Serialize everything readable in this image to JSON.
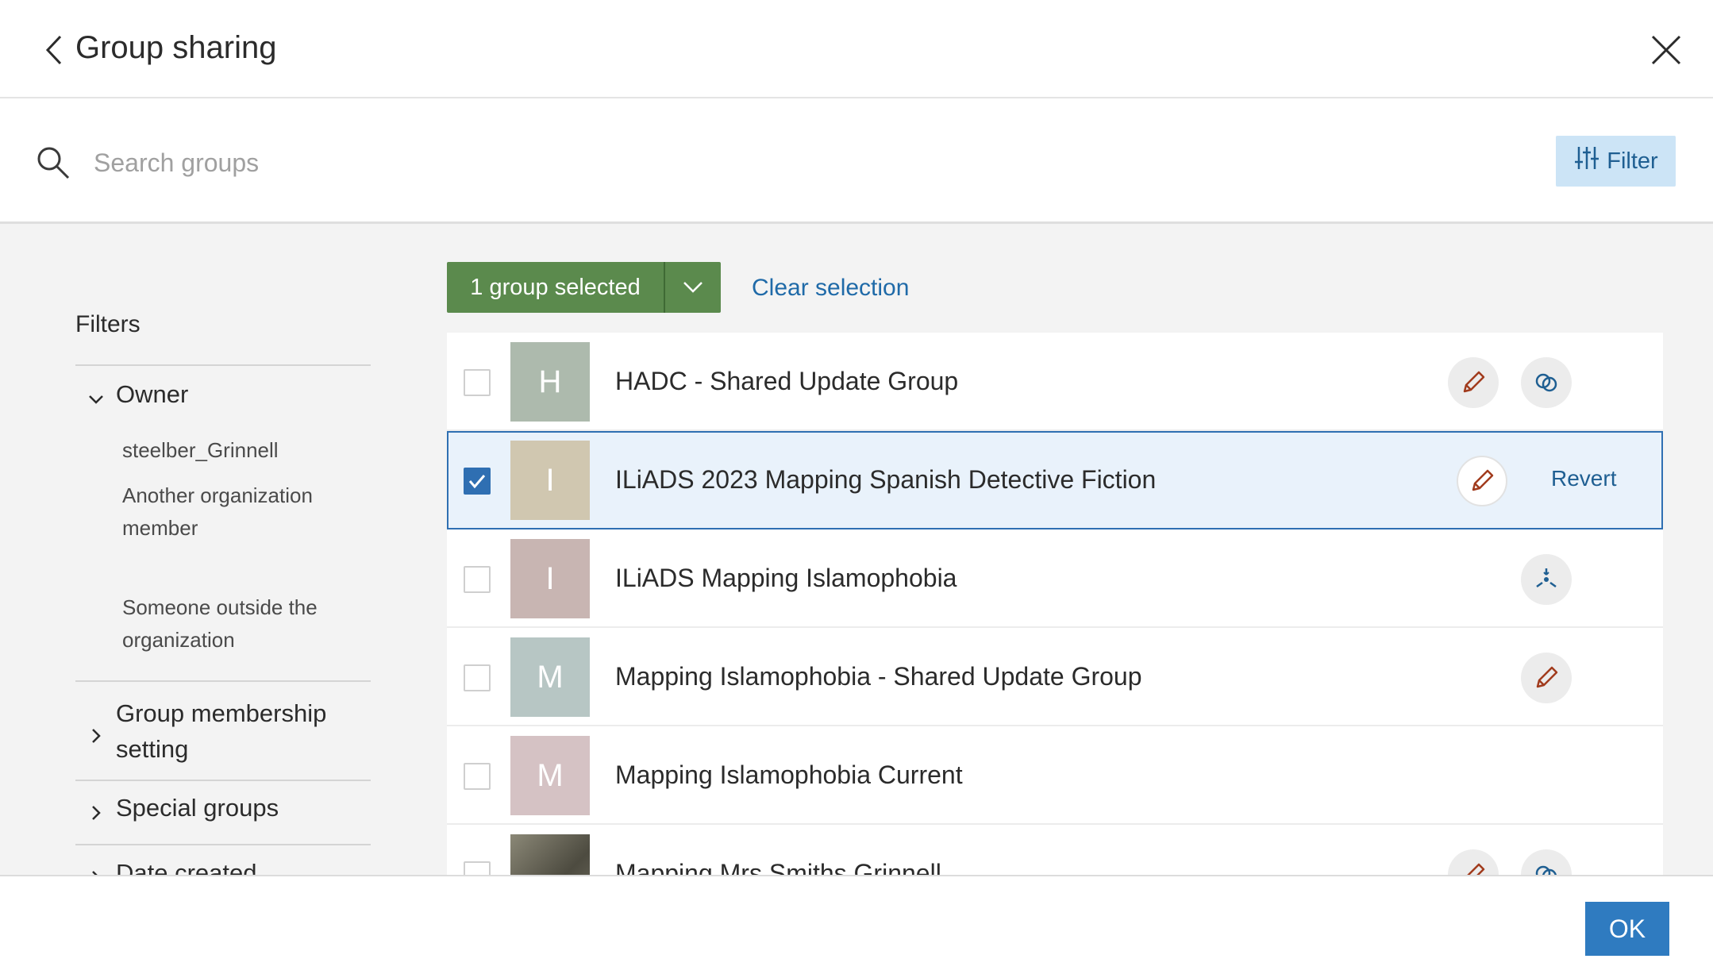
{
  "header": {
    "title": "Group sharing"
  },
  "search": {
    "placeholder": "Search groups",
    "filter_label": "Filter"
  },
  "filters": {
    "title": "Filters",
    "owner": {
      "label": "Owner",
      "options": [
        "steelber_Grinnell",
        "Another organization member",
        "Someone outside the organization"
      ]
    },
    "group_membership_setting": "Group membership setting",
    "special_groups": "Special groups",
    "date_created": "Date created"
  },
  "selection": {
    "label": "1 group selected",
    "clear": "Clear selection"
  },
  "groups": [
    {
      "initial": "H",
      "name": "HADC - Shared Update Group",
      "checked": false,
      "thumb_color": "#adbaad",
      "actions": [
        "pencil-icon",
        "link-icon"
      ]
    },
    {
      "initial": "I",
      "name": "ILiADS 2023 Mapping Spanish Detective Fiction",
      "checked": true,
      "thumb_color": "#d0c7b0",
      "actions": [
        "pencil-icon"
      ],
      "revert": "Revert"
    },
    {
      "initial": "I",
      "name": "ILiADS Mapping Islamophobia",
      "checked": false,
      "thumb_color": "#c8b5b2",
      "actions": [
        "partnered-icon"
      ]
    },
    {
      "initial": "M",
      "name": "Mapping Islamophobia - Shared Update Group",
      "checked": false,
      "thumb_color": "#b7c6c4",
      "actions": [
        "pencil-icon"
      ]
    },
    {
      "initial": "M",
      "name": "Mapping Islamophobia Current",
      "checked": false,
      "thumb_color": "#d5c2c4",
      "actions": []
    },
    {
      "initial": "",
      "name": "Mapping Mrs Smiths Grinnell",
      "checked": false,
      "thumb_color": "#6d6a5c",
      "actions": [
        "pencil-icon",
        "link-icon"
      ]
    }
  ],
  "footer": {
    "ok": "OK"
  },
  "colors": {
    "accent": "#2f7bc0",
    "selection_green": "#5b8a4d",
    "edit_icon": "#a13b1d"
  }
}
